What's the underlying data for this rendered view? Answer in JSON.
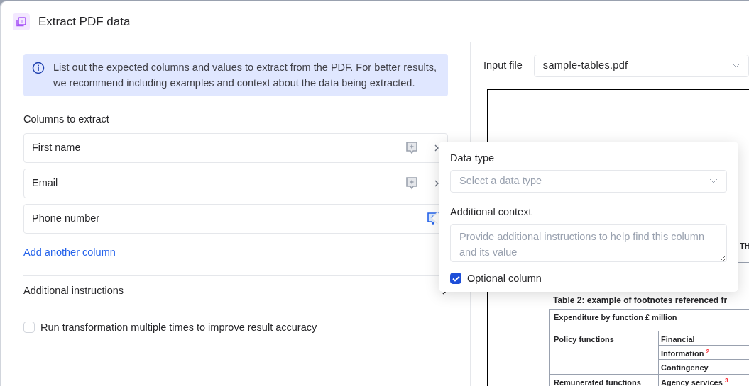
{
  "dialog": {
    "title": "Extract PDF data"
  },
  "info_banner": "List out the expected columns and values to extract from the PDF. For better results, we recommend including examples and context about the data being extracted.",
  "columns_section": {
    "label": "Columns to extract",
    "columns": [
      {
        "name": "First name",
        "context_active": false
      },
      {
        "name": "Email",
        "context_active": false
      },
      {
        "name": "Phone number",
        "context_active": true
      }
    ],
    "add_link": "Add another column"
  },
  "additional_instructions": {
    "label": "Additional instructions"
  },
  "run_multiple": {
    "label": "Run transformation multiple times to improve result accuracy",
    "checked": false
  },
  "input_file": {
    "label": "Input file",
    "value": "sample-tables.pdf"
  },
  "pdf_preview": {
    "partial_header": "TH",
    "table_title": "Table 2: example of footnotes referenced fr",
    "table_heading": "Expenditure by function £ million",
    "rows": [
      {
        "group": "Policy functions",
        "items": [
          "Financial",
          "Information $^{2}$",
          "Contingency"
        ]
      },
      {
        "group": "Remunerated functions",
        "items": [
          "Agency services $^{3}$"
        ]
      }
    ]
  },
  "popover": {
    "data_type_label": "Data type",
    "data_type_placeholder": "Select a data type",
    "context_label": "Additional context",
    "context_placeholder": "Provide additional instructions to help find this column and its value",
    "optional": {
      "label": "Optional column",
      "checked": true
    }
  }
}
